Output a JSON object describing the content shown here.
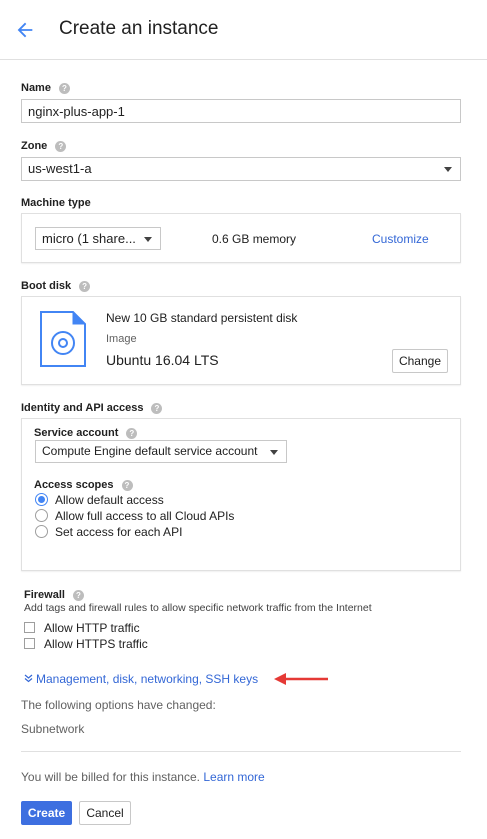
{
  "header": {
    "title": "Create an instance"
  },
  "name": {
    "label": "Name",
    "value": "nginx-plus-app-1"
  },
  "zone": {
    "label": "Zone",
    "value": "us-west1-a"
  },
  "machine_type": {
    "label": "Machine type",
    "value": "micro (1 share...",
    "memory": "0.6 GB memory",
    "customize": "Customize"
  },
  "boot_disk": {
    "label": "Boot disk",
    "title": "New 10 GB standard persistent disk",
    "image_label": "Image",
    "image_value": "Ubuntu 16.04 LTS",
    "change": "Change"
  },
  "identity": {
    "label": "Identity and API access",
    "service_account_label": "Service account",
    "service_account_value": "Compute Engine default service account",
    "access_scopes_label": "Access scopes",
    "scopes": [
      {
        "label": "Allow default access",
        "checked": true
      },
      {
        "label": "Allow full access to all Cloud APIs",
        "checked": false
      },
      {
        "label": "Set access for each API",
        "checked": false
      }
    ]
  },
  "firewall": {
    "label": "Firewall",
    "description": "Add tags and firewall rules to allow specific network traffic from the Internet",
    "http": "Allow HTTP traffic",
    "https": "Allow HTTPS traffic"
  },
  "management": {
    "link": "Management, disk, networking, SSH keys",
    "changed_text": "The following options have changed:",
    "changed_item": "Subnetwork"
  },
  "billing": {
    "text": "You will be billed for this instance.",
    "learn_more": "Learn more"
  },
  "actions": {
    "create": "Create",
    "cancel": "Cancel"
  },
  "colors": {
    "accent": "#4285f4",
    "link": "#3367d6",
    "primary_button": "#3d6fe0",
    "arrow": "#e53935"
  }
}
